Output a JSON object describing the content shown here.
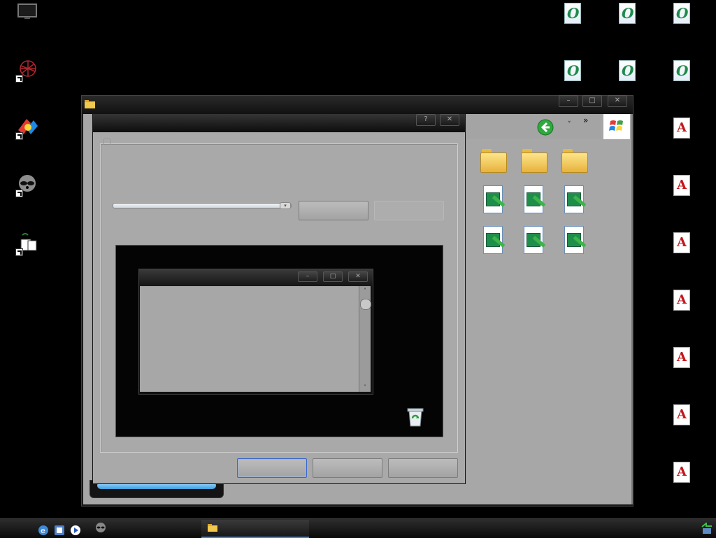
{
  "desktop": {
    "left_icons": [
      {
        "name": "my-computer-icon"
      },
      {
        "name": "network-shortcut-icon"
      },
      {
        "name": "app-shortcut-icon"
      },
      {
        "name": "raccoon-shortcut-icon"
      },
      {
        "name": "game-shortcut-icon"
      }
    ],
    "right_icons": {
      "opera_label": "O",
      "acrobat_label": "A"
    }
  },
  "explorer": {
    "title": "",
    "nav": {
      "more": "»"
    }
  },
  "dialog": {
    "title": "",
    "help_label": "?",
    "close_label": "✕",
    "preview": {
      "window_title": "",
      "minimize_label": "–",
      "maximize_label": "□",
      "close_label": "✕",
      "scroll_up": "˄",
      "scroll_down": "˅"
    },
    "buttons": {
      "ok": "",
      "cancel": "",
      "apply": "",
      "settings": "",
      "advanced": ""
    }
  },
  "taskbar": {
    "task_label": "",
    "accent": "#3b82d9"
  },
  "colors": {
    "desktop": "#000000",
    "window_face": "#a9a9a9",
    "titlebar": "#1a1a1a"
  }
}
